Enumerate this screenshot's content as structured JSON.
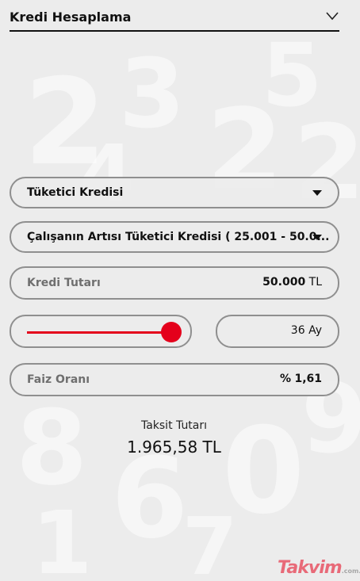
{
  "header": {
    "title": "Kredi Hesaplama",
    "chevron_icon": "chevron-down-icon"
  },
  "form": {
    "loan_type": "Tüketici Kredisi",
    "loan_product": "Çalışanın Artısı Tüketici Kredisi ( 25.001 - 50.0...",
    "amount": {
      "label": "Kredi Tutarı",
      "value": "50.000",
      "unit": "TL"
    },
    "term": {
      "slider_fraction": 1.0,
      "value": "36",
      "unit": "Ay"
    },
    "interest": {
      "label": "Faiz Oranı",
      "prefix": "%",
      "value": "1,61"
    }
  },
  "result": {
    "label": "Taksit Tutarı",
    "value": "1.965,58 TL"
  },
  "watermark": {
    "brand": "Takvim",
    "suffix": ".com.tr"
  },
  "colors": {
    "accent": "#e4001b",
    "border": "#8f8f8f",
    "background": "#ececec"
  }
}
